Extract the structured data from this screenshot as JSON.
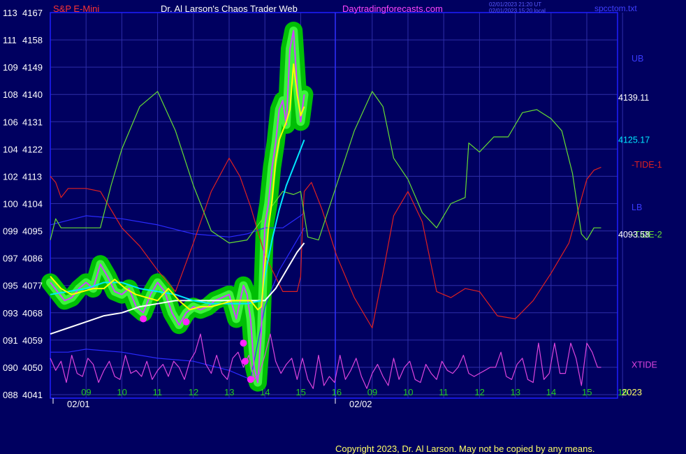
{
  "header": {
    "symbol": "S&P E-Mini",
    "title": "Dr. Al Larson's Chaos Trader Web",
    "site": "Daytradingforecasts.com",
    "timestamp_ut": "02/01/2023 21:20 UT",
    "timestamp_local": "02/01/2023 15:20 local",
    "file": "spcctom.txt",
    "copyright": "Copyright 2023, Dr. Al Larson. May not be copied by any means."
  },
  "colors": {
    "background": "#000060",
    "frame": "#1f1fff",
    "grid": "#2e2ea8",
    "price_bars": "#cc44ff",
    "price_glow": "#00c800",
    "price_glow_light": "#44ff44",
    "fast_ma": "#ffff00",
    "slow_ma": "#00e8ff",
    "long_ma": "#ffffff",
    "tide1": "#e02020",
    "tide2": "#66dd33",
    "band": "#2a2aff",
    "xtide": "#dd44dd",
    "marker": "#ff22ff"
  },
  "chart_data": {
    "type": "line",
    "xaxis": {
      "hour_ticks": [
        "09",
        "10",
        "11",
        "12",
        "13",
        "14",
        "15",
        "16",
        "09",
        "10",
        "11",
        "12",
        "13",
        "14",
        "15",
        "16"
      ],
      "dates": [
        "02/01",
        "02/02"
      ],
      "year": "2023"
    },
    "yaxis": {
      "range": [
        4041,
        4167
      ],
      "ticks": [
        {
          "left": "113",
          "right": "4167"
        },
        {
          "left": "111",
          "right": "4158"
        },
        {
          "left": "109",
          "right": "4149"
        },
        {
          "left": "108",
          "right": "4140"
        },
        {
          "left": "106",
          "right": "4131"
        },
        {
          "left": "104",
          "right": "4122"
        },
        {
          "left": "102",
          "right": "4113"
        },
        {
          "left": "100",
          "right": "4104"
        },
        {
          "left": "099",
          "right": "4095"
        },
        {
          "left": "097",
          "right": "4086"
        },
        {
          "left": "095",
          "right": "4077"
        },
        {
          "left": "093",
          "right": "4068"
        },
        {
          "left": "091",
          "right": "4059"
        },
        {
          "left": "090",
          "right": "4050"
        },
        {
          "left": "088",
          "right": "4041"
        }
      ]
    },
    "right_labels": [
      {
        "text": "UB",
        "color": "#3a3aff",
        "y": 4152
      },
      {
        "text": "4139.11",
        "color": "#ffffff",
        "y": 4139.1
      },
      {
        "text": "4125.17",
        "color": "#00e8ff",
        "y": 4125.2
      },
      {
        "text": "-TIDE-1",
        "color": "#e02020",
        "y": 4117
      },
      {
        "text": "LB",
        "color": "#3a3aff",
        "y": 4103
      },
      {
        "text": "-TIDE-2",
        "color": "#66dd33",
        "y": 4094
      },
      {
        "text": "4093.58",
        "color": "#ffffff",
        "y": 4094
      },
      {
        "text": "XTIDE",
        "color": "#dd44dd",
        "y": 4051
      }
    ],
    "series": [
      {
        "key": "price",
        "name": "S&P E-Mini",
        "color": "#cc44ff",
        "x": [
          0,
          0.2,
          0.4,
          0.6,
          0.8,
          1,
          1.2,
          1.4,
          1.6,
          1.8,
          2,
          2.2,
          2.4,
          2.6,
          2.8,
          3,
          3.2,
          3.4,
          3.6,
          3.8,
          4,
          4.2,
          4.4,
          4.6,
          4.8,
          5,
          5.2,
          5.4,
          5.5,
          5.6,
          5.7,
          5.8,
          5.9,
          6,
          6.1,
          6.2,
          6.3,
          6.4,
          6.5,
          6.6,
          6.7,
          6.8,
          6.9,
          7,
          7.1
        ],
        "y": [
          4078,
          4075,
          4072,
          4073,
          4076,
          4078,
          4076,
          4084,
          4080,
          4075,
          4074,
          4076,
          4070,
          4068,
          4074,
          4078,
          4075,
          4068,
          4064,
          4068,
          4070,
          4069,
          4070,
          4072,
          4073,
          4074,
          4066,
          4077,
          4074,
          4066,
          4050,
          4045,
          4062,
          4097,
          4104,
          4116,
          4124,
          4135,
          4138,
          4130,
          4155,
          4161,
          4143,
          4131,
          4140
        ]
      },
      {
        "key": "fast_ma",
        "name": "",
        "color": "#ffff00",
        "x": [
          0,
          0.3,
          0.6,
          0.9,
          1.2,
          1.5,
          1.8,
          2.1,
          2.4,
          2.7,
          3,
          3.3,
          3.6,
          3.9,
          4.2,
          4.5,
          4.8,
          5.1,
          5.4,
          5.6,
          5.8,
          5.9,
          6,
          6.1,
          6.2,
          6.3,
          6.4,
          6.5,
          6.6,
          6.7,
          6.8,
          6.9,
          7,
          7.1
        ],
        "y": [
          4080,
          4076,
          4074,
          4075,
          4076,
          4076,
          4079,
          4076,
          4074,
          4073,
          4072,
          4076,
          4072,
          4069,
          4070,
          4070,
          4071,
          4072,
          4072,
          4072,
          4069,
          4070,
          4084,
          4096,
          4105,
          4118,
          4125,
          4128,
          4131,
          4135,
          4150,
          4140,
          4133,
          4136
        ]
      },
      {
        "key": "slow_ma",
        "name": "",
        "color": "#00e8ff",
        "x": [
          0,
          0.5,
          1,
          1.5,
          2,
          2.5,
          3,
          3.5,
          4,
          4.5,
          5,
          5.5,
          5.9,
          6,
          6.2,
          6.4,
          6.6,
          6.8,
          7,
          7.1
        ],
        "y": [
          4074,
          4075,
          4076,
          4078,
          4078,
          4076,
          4075,
          4074,
          4072,
          4071,
          4071,
          4071,
          4072,
          4080,
          4092,
          4102,
          4110,
          4116,
          4122,
          4125
        ]
      },
      {
        "key": "long_ma",
        "name": "",
        "color": "#ffffff",
        "x": [
          0,
          0.5,
          1,
          1.5,
          2,
          2.5,
          3,
          3.5,
          4,
          4.5,
          5,
          5.5,
          6,
          6.3,
          6.6,
          6.9,
          7.1
        ],
        "y": [
          4061,
          4063,
          4065,
          4067,
          4068,
          4070,
          4071,
          4072,
          4072,
          4072,
          4072,
          4072,
          4072,
          4076,
          4082,
          4088,
          4091
        ]
      },
      {
        "key": "tide1",
        "name": "-TIDE-1",
        "color": "#e02020",
        "x": [
          0,
          0.15,
          0.3,
          0.5,
          1,
          1.4,
          1.7,
          2,
          2.5,
          3,
          3.5,
          4,
          4.5,
          5,
          5.3,
          5.6,
          6,
          6.5,
          6.9,
          7,
          7.05,
          7.1,
          7.3,
          7.6,
          8,
          8.5,
          9,
          9.3,
          9.6,
          10,
          10.4,
          10.8,
          11.2,
          11.6,
          12,
          12.5,
          13,
          13.5,
          14,
          14.5,
          15,
          15.2,
          15.4
        ],
        "y": [
          4113,
          4111,
          4106,
          4109,
          4109,
          4108,
          4102,
          4096,
          4090,
          4082,
          4075,
          4091,
          4108,
          4119,
          4113,
          4103,
          4087,
          4075,
          4075,
          4080,
          4097,
          4108,
          4111,
          4102,
          4087,
          4073,
          4063,
          4081,
          4100,
          4108,
          4098,
          4075,
          4073,
          4076,
          4075,
          4067,
          4066,
          4072,
          4081,
          4091,
          4112,
          4115,
          4116
        ]
      },
      {
        "key": "tide2",
        "name": "-TIDE-2",
        "color": "#66dd33",
        "x": [
          0,
          0.15,
          0.3,
          0.5,
          1,
          1.4,
          1.7,
          2,
          2.5,
          3,
          3.5,
          4,
          4.5,
          5,
          5.5,
          6,
          6.5,
          6.8,
          7,
          7.2,
          7.5,
          8,
          8.5,
          9,
          9.3,
          9.6,
          10,
          10.4,
          10.8,
          11.2,
          11.6,
          11.7,
          12,
          12.4,
          12.8,
          13.2,
          13.6,
          14,
          14.3,
          14.6,
          14.85,
          15,
          15.2,
          15.4
        ],
        "y": [
          4092,
          4099,
          4096,
          4096,
          4096,
          4096,
          4110,
          4122,
          4136,
          4141,
          4128,
          4110,
          4095,
          4091,
          4092,
          4100,
          4108,
          4107,
          4108,
          4093,
          4092,
          4110,
          4128,
          4141,
          4136,
          4119,
          4112,
          4101,
          4096,
          4104,
          4106,
          4124,
          4121,
          4126,
          4126,
          4134,
          4135,
          4132,
          4128,
          4114,
          4094,
          4092,
          4096,
          4096
        ]
      },
      {
        "key": "ub",
        "name": "UB",
        "color": "#2a2aff",
        "x": [
          0,
          1,
          2,
          3,
          4,
          5,
          5.5,
          6,
          6.5,
          7,
          7.1
        ],
        "y": [
          4097,
          4100,
          4099,
          4097,
          4094,
          4093,
          4094,
          4096,
          4096,
          4100,
          4101
        ]
      },
      {
        "key": "lb",
        "name": "LB",
        "color": "#2a2aff",
        "x": [
          0,
          0.5,
          1,
          2,
          3,
          4,
          5,
          5.6,
          6,
          6.4,
          6.8,
          7,
          7.1
        ],
        "y": [
          4055,
          4055,
          4056,
          4055,
          4053,
          4052,
          4049,
          4046,
          4070,
          4082,
          4090,
          4094,
          4096
        ]
      },
      {
        "key": "xtide",
        "name": "XTIDE",
        "color": "#dd44dd",
        "x": [
          0,
          0.15,
          0.3,
          0.45,
          0.6,
          0.75,
          0.9,
          1.05,
          1.2,
          1.35,
          1.5,
          1.65,
          1.8,
          1.95,
          2.1,
          2.25,
          2.4,
          2.55,
          2.7,
          2.85,
          3,
          3.15,
          3.3,
          3.45,
          3.6,
          3.75,
          3.9,
          4.05,
          4.2,
          4.35,
          4.5,
          4.65,
          4.8,
          4.95,
          5.1,
          5.25,
          5.4,
          5.55,
          5.7,
          5.85,
          6,
          6.15,
          6.3,
          6.45,
          6.6,
          6.75,
          6.9,
          7.05,
          7.2,
          7.35,
          7.5,
          7.65,
          7.8,
          7.95,
          8.1,
          8.25,
          8.4,
          8.55,
          8.7,
          8.85,
          9,
          9.15,
          9.3,
          9.45,
          9.6,
          9.75,
          9.9,
          10.05,
          10.2,
          10.35,
          10.5,
          10.65,
          10.8,
          10.95,
          11.1,
          11.25,
          11.4,
          11.55,
          11.7,
          11.85,
          12,
          12.15,
          12.3,
          12.45,
          12.6,
          12.75,
          12.9,
          13.05,
          13.2,
          13.35,
          13.5,
          13.65,
          13.8,
          13.95,
          14.1,
          14.25,
          14.4,
          14.55,
          14.7,
          14.85,
          15,
          15.15,
          15.3,
          15.4
        ],
        "y": [
          4053,
          4049,
          4052,
          4045,
          4054,
          4048,
          4047,
          4053,
          4051,
          4045,
          4049,
          4052,
          4047,
          4046,
          4054,
          4048,
          4049,
          4047,
          4052,
          4046,
          4049,
          4051,
          4047,
          4052,
          4050,
          4046,
          4052,
          4055,
          4061,
          4051,
          4048,
          4054,
          4048,
          4046,
          4053,
          4055,
          4050,
          4054,
          4046,
          4048,
          4054,
          4061,
          4052,
          4048,
          4051,
          4053,
          4046,
          4053,
          4046,
          4043,
          4054,
          4044,
          4047,
          4045,
          4054,
          4046,
          4049,
          4053,
          4047,
          4043,
          4048,
          4051,
          4047,
          4044,
          4053,
          4046,
          4050,
          4052,
          4046,
          4045,
          4051,
          4048,
          4046,
          4052,
          4049,
          4048,
          4050,
          4054,
          4048,
          4047,
          4048,
          4049,
          4050,
          4050,
          4055,
          4047,
          4046,
          4051,
          4053,
          4046,
          4045,
          4058,
          4046,
          4048,
          4058,
          4048,
          4048,
          4058,
          4053,
          4044,
          4058,
          4055,
          4050,
          4050
        ]
      },
      {
        "key": "markers",
        "name": "",
        "color": "#ff22ff",
        "x": [
          2.6,
          3.8,
          5.4,
          5.45,
          5.6
        ],
        "y": [
          4066,
          4065,
          4058,
          4052,
          4046
        ]
      }
    ],
    "grid": true,
    "legend": "right"
  }
}
